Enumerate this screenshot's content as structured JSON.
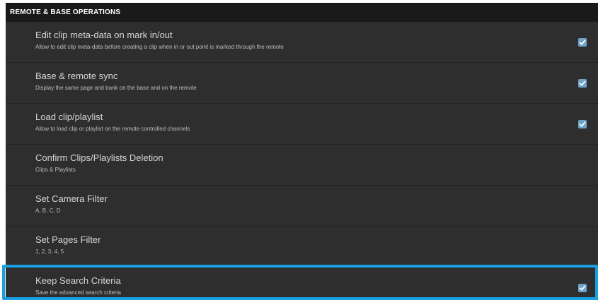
{
  "section": {
    "title": "REMOTE & BASE OPERATIONS"
  },
  "settings": [
    {
      "title": "Edit clip meta-data on mark in/out",
      "description": "Allow to edit clip meta-data before creating a clip when in or out point is marked through the remote",
      "checked": true
    },
    {
      "title": "Base & remote sync",
      "description": "Display the same page and bank on the base and on the remote",
      "checked": true
    },
    {
      "title": "Load clip/playlist",
      "description": "Allow to load clip or playlist on the remote controlled channels",
      "checked": true
    },
    {
      "title": "Confirm Clips/Playlists Deletion",
      "description": "Clips & Playlists",
      "checked": false
    },
    {
      "title": "Set Camera Filter",
      "description": "A, B, C, D",
      "checked": false
    },
    {
      "title": "Set Pages Filter",
      "description": "1, 2, 3, 4, 5",
      "checked": false
    },
    {
      "title": "Keep Search Criteria",
      "description": "Save the advanced search criteria",
      "checked": true
    }
  ],
  "colors": {
    "panel_bg": "#2e2e2e",
    "header_bg": "#1a1a1a",
    "checkbox": "#6fa3c8",
    "highlight": "#1aa0e0"
  }
}
